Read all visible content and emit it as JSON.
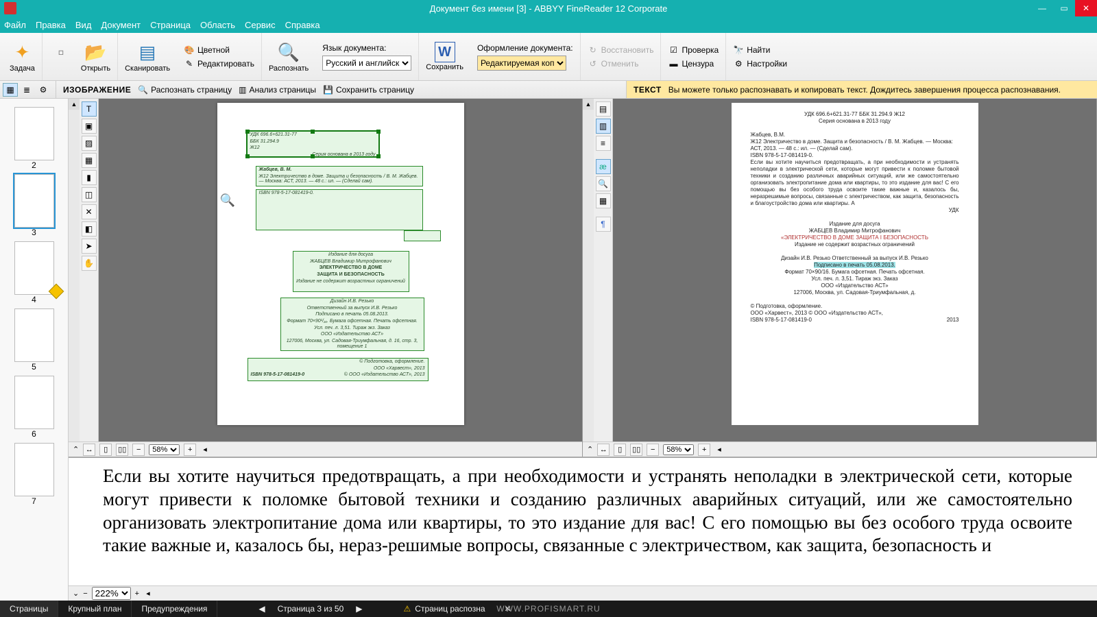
{
  "window": {
    "title": "Документ без имени [3] - ABBYY FineReader 12 Corporate"
  },
  "menu": [
    "Файл",
    "Правка",
    "Вид",
    "Документ",
    "Страница",
    "Область",
    "Сервис",
    "Справка"
  ],
  "ribbon": {
    "task": "Задача",
    "open": "Открыть",
    "scan": "Сканировать",
    "color": "Цветной",
    "edit": "Редактировать",
    "read": "Распознать",
    "lang_label": "Язык документа:",
    "lang_value": "Русский и английский",
    "save": "Сохранить",
    "layout_label": "Оформление документа:",
    "layout_value": "Редактируемая копия",
    "restore": "Восстановить",
    "undo": "Отменить",
    "verify": "Проверка",
    "censor": "Цензура",
    "find": "Найти",
    "settings": "Настройки"
  },
  "secondbar": {
    "image_hdr": "ИЗОБРАЖЕНИЕ",
    "read_page": "Распознать страницу",
    "analyze_page": "Анализ страницы",
    "save_page": "Сохранить страницу",
    "text_hdr": "ТЕКСТ",
    "text_msg": "Вы можете только распознавать и копировать текст. Дождитесь завершения процесса распознавания."
  },
  "thumbs": [
    {
      "num": "2",
      "sel": false,
      "warn": false
    },
    {
      "num": "3",
      "sel": true,
      "warn": false
    },
    {
      "num": "4",
      "sel": false,
      "warn": true
    },
    {
      "num": "5",
      "sel": false,
      "warn": false
    },
    {
      "num": "6",
      "sel": false,
      "warn": false
    },
    {
      "num": "7",
      "sel": false,
      "warn": false
    }
  ],
  "image_page": {
    "udk": "УДК 696.6+621.31-77",
    "bbk": "ББК 31.294.9",
    "code": "Ж12",
    "series": "Серия основана в 2013 году",
    "author": "Жабцев, В. М.",
    "desc": "Ж12  Электричество в доме. Защита и безопасность / В. М. Жабцев. — Москва: АСТ, 2013. — 48 с.: ил. — (Сделай сам).",
    "isbn": "ISBN 978-5-17-081419-0.",
    "zoom": "58%",
    "title_block1": "Издание для досуга",
    "title_block2": "ЖАБЦЕВ Владимир Митрофанович",
    "title_block3": "ЭЛЕКТРИЧЕСТВО В ДОМЕ",
    "title_block4": "ЗАЩИТА И БЕЗОПАСНОСТЬ",
    "title_block5": "Издание не содержит возрастных ограничений",
    "imprint1": "Дизайн И.В. Резько",
    "imprint2": "Ответственный за выпуск И.В. Резько",
    "imprint3": "Подписано в печать 05.08.2013.",
    "imprint4": "Формат 70×90¹/₁₆. Бумага офсетная. Печать офсетная.",
    "imprint5": "Усл. печ. л. 3,51. Тираж    экз. Заказ",
    "imprint6": "ООО «Издательство АСТ»",
    "imprint7": "127006, Москва, ул. Садовая-Триумфальная, д. 16, стр. 3, помещение 1",
    "isbn_bottom": "ISBN 978-5-17-081419-0",
    "copyright1": "© Подготовка, оформление.",
    "copyright2": "ООО «Харвест», 2013",
    "copyright3": "© ООО «Издательство АСТ», 2013"
  },
  "text_page": {
    "udk": "УДК 696.6+621.31-77 ББК 31.294.9 Ж12",
    "series": "Серия основана в 2013 году",
    "author": "Жабцев, В.М.",
    "desc": "Ж12 Электричество в доме. Защита и безопасность / В. М. Жабцев. — Москва: АСТ, 2013. — 48 с.: ил. — (Сделай сам).",
    "isbn": "ISBN 978-5-17-081419-0.",
    "para": "Если вы хотите научиться предотвращать, а при необходимости и устранять неполадки в электрической сети, которые могут привести к поломке бытовой техники и созданию различных аварийных ситуаций, или же самостоятельно организовать электропитание дома или квартиры, то это издание для вас! С его помощью вы без особого труда освоите такие важные и, казалось бы, неразрешимые вопросы, связанные с электричеством, как защита, безопасность и благоустройство дома или квартиры. А",
    "ed1": "Издание для досуга",
    "ed2": "ЖАБЦЕВ Владимир Митрофанович",
    "ed3": "«ЭЛЕКТРИЧЕСТВО В ДОМЕ ЗАЩИТА I БЕЗОПАСНОСТЬ",
    "ed4": "Издание не содержит возрастных ограничений",
    "dz1": "Дизайн И.В. Резько Ответственный за выпуск И.В. Резько",
    "dz2": "Подписано в печать 05.08.2013.",
    "dz3": "Формат 70×90/16. Бумага офсетная. Печать офсетная.",
    "dz4": "Усл. печ. л. 3,51. Тираж экз. Заказ",
    "dz5": "ООО «Издательство АСТ»",
    "dz6": "127006, Москва, ул. Садовая-Триумфальная, д.",
    "cp1": "© Подготовка, оформление.",
    "cp2": "ООО «Харвест», 2013 © ООО «Издательство АСТ»,",
    "cp3": "ISBN 978-5-17-081419-0",
    "cp4": "2013",
    "zoom": "58%"
  },
  "zoom": {
    "text": "Если вы хотите научиться предотвращать, а при необходимости и устранять неполадки в электрической сети, которые могут привести к поломке бытовой техники и созданию различных аварийных ситуаций, или же самостоятельно организовать электропитание дома или квартиры, то это издание для вас! С его помощью вы без особого труда освоите такие важные и, казалось бы, нераз-решимые вопросы, связанные с электричеством, как защита, безопасность и",
    "value": "222%"
  },
  "status": {
    "pages": "Страницы",
    "close_up": "Крупный план",
    "warnings": "Предупреждения",
    "nav": "Страница 3 из 50",
    "recog": "Страниц распозна",
    "watermark": "WWW.PROFISMART.RU"
  }
}
